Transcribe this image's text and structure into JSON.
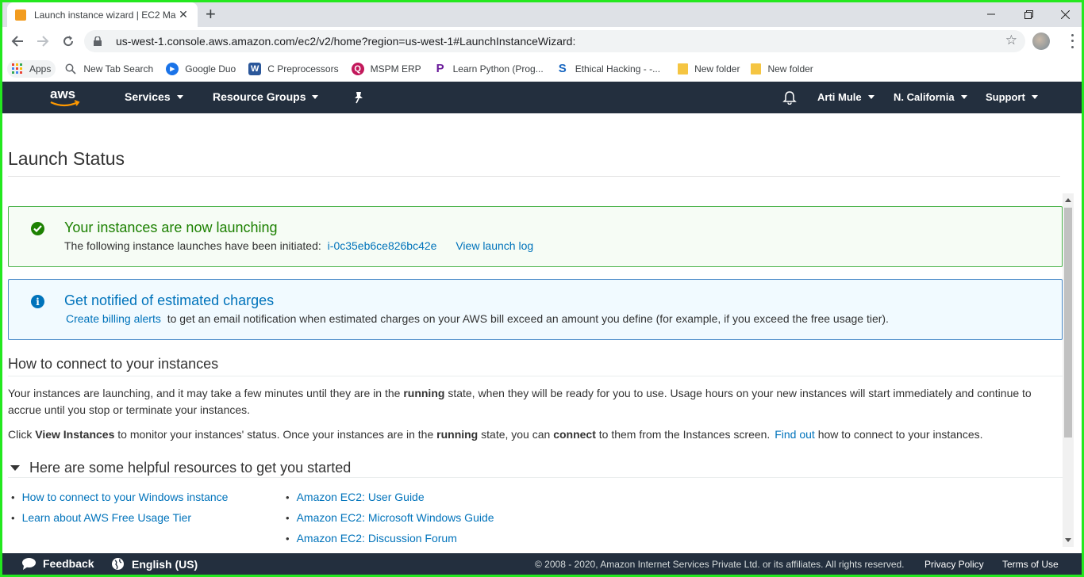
{
  "browser": {
    "tab_title": "Launch instance wizard | EC2 Ma",
    "new_tab": "+",
    "url": "us-west-1.console.aws.amazon.com/ec2/v2/home?region=us-west-1#LaunchInstanceWizard:",
    "bookmarks": [
      {
        "label": "Apps",
        "icon": "apps-grid-icon"
      },
      {
        "label": "New Tab Search",
        "icon": "search-icon"
      },
      {
        "label": "Google Duo",
        "icon": "duo-icon",
        "color": "#1a73e8"
      },
      {
        "label": "C Preprocessors",
        "icon": "word-icon",
        "color": "#2b579a"
      },
      {
        "label": "MSPM ERP",
        "icon": "erp-icon",
        "color": "#c2185b"
      },
      {
        "label": "Learn Python (Prog...",
        "icon": "python-icon",
        "color": "#6a1b9a"
      },
      {
        "label": "Ethical Hacking - -...",
        "icon": "s-icon",
        "color": "#1565c0"
      },
      {
        "label": "New folder",
        "icon": "folder-icon",
        "color": "#f5c542"
      },
      {
        "label": "New folder",
        "icon": "folder-icon",
        "color": "#f5c542"
      }
    ]
  },
  "aws_nav": {
    "logo": "aws",
    "services": "Services",
    "resource_groups": "Resource Groups",
    "user": "Arti Mule",
    "region": "N. California",
    "support": "Support"
  },
  "page": {
    "title": "Launch Status",
    "success": {
      "title": "Your instances are now launching",
      "body_prefix": "The following instance launches have been initiated:",
      "instance_id": "i-0c35eb6ce826bc42e",
      "view_log": "View launch log"
    },
    "info": {
      "title": "Get notified of estimated charges",
      "link": "Create billing alerts",
      "body": "to get an email notification when estimated charges on your AWS bill exceed an amount you define (for example, if you exceed the free usage tier)."
    },
    "connect": {
      "heading": "How to connect to your instances",
      "p1_a": "Your instances are launching, and it may take a few minutes until they are in the",
      "p1_bold": "running",
      "p1_b": "state, when they will be ready for you to use. Usage hours on your new instances will start immediately and continue to accrue until you stop or terminate your instances.",
      "p2_a": "Click",
      "p2_bold1": "View Instances",
      "p2_b": "to monitor your instances' status. Once your instances are in the",
      "p2_bold2": "running",
      "p2_c": "state, you can",
      "p2_bold3": "connect",
      "p2_d": "to them from the Instances screen.",
      "p2_link": "Find out",
      "p2_e": "how to connect to your instances."
    },
    "resources": {
      "heading": "Here are some helpful resources to get you started",
      "col1": [
        "How to connect to your Windows instance",
        "Learn about AWS Free Usage Tier"
      ],
      "col2": [
        "Amazon EC2: User Guide",
        "Amazon EC2: Microsoft Windows Guide",
        "Amazon EC2: Discussion Forum"
      ]
    }
  },
  "footer": {
    "feedback": "Feedback",
    "language": "English (US)",
    "copyright": "© 2008 - 2020, Amazon Internet Services Private Ltd. or its affiliates. All rights reserved.",
    "privacy": "Privacy Policy",
    "terms": "Terms of Use"
  }
}
